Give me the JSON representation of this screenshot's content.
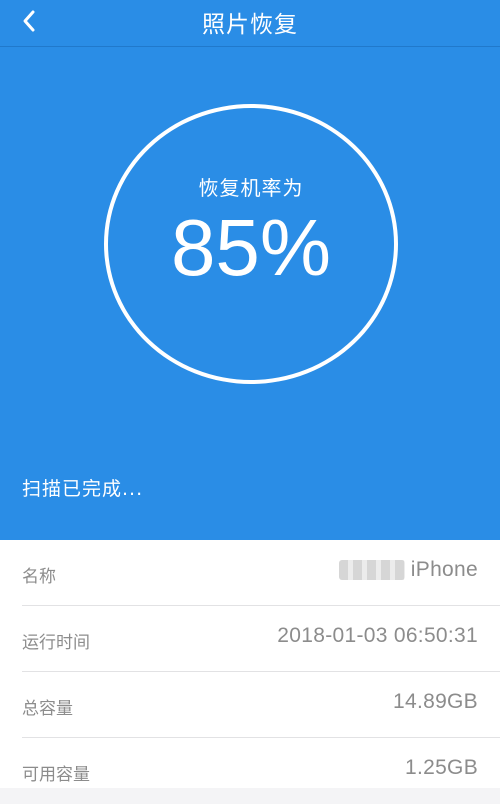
{
  "nav": {
    "title": "照片恢复",
    "back_icon": "chevron-left-icon"
  },
  "hero": {
    "ring_label": "恢复机率为",
    "percent_text": "85%",
    "percent_value": 85,
    "status_text": "扫描已完成...",
    "background_color": "#2a8de6"
  },
  "info": {
    "rows": [
      {
        "label": "名称",
        "value": "iPhone"
      },
      {
        "label": "运行时间",
        "value": "2018-01-03 06:50:31"
      },
      {
        "label": "总容量",
        "value": "14.89GB"
      },
      {
        "label": "可用容量",
        "value": "1.25GB"
      }
    ]
  }
}
